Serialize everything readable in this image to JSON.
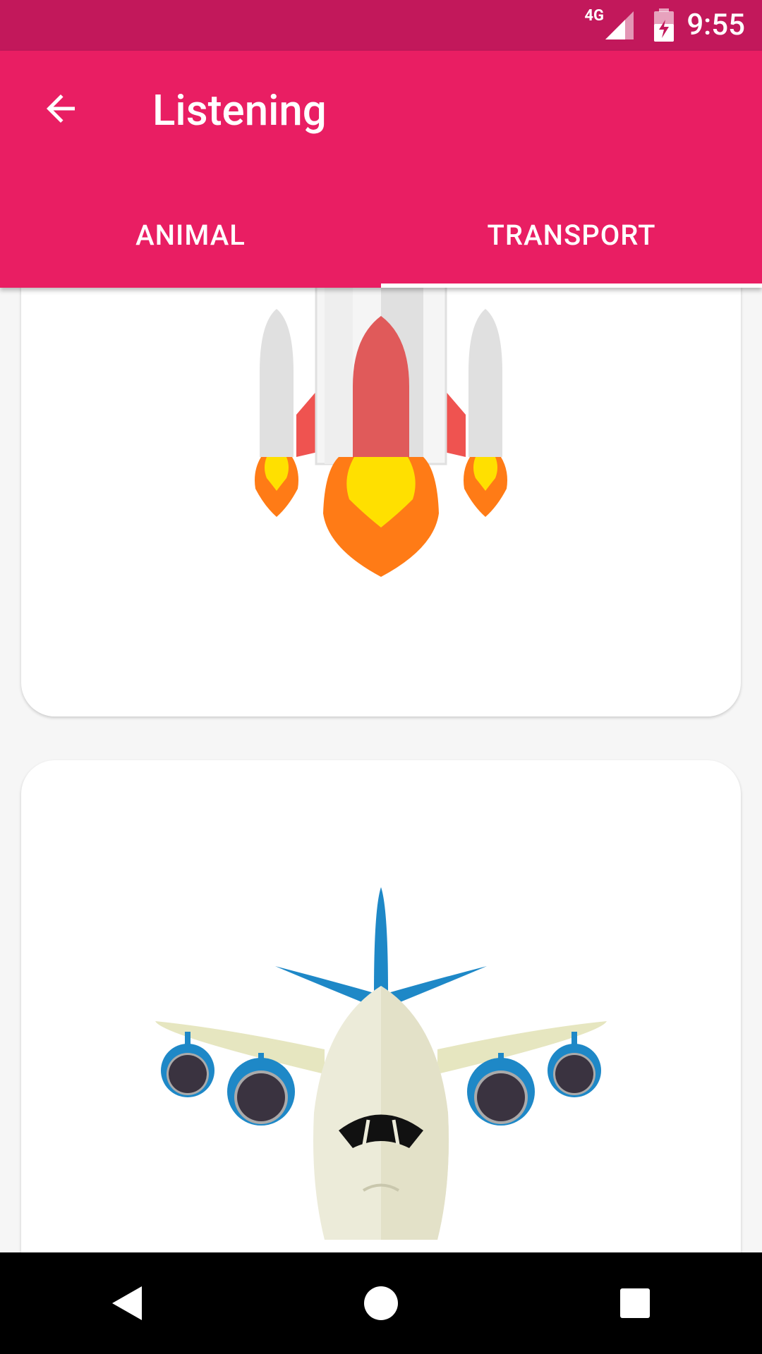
{
  "status_bar": {
    "time": "9:55",
    "network": "4G"
  },
  "app_bar": {
    "title": "Listening"
  },
  "tabs": [
    {
      "label": "ANIMAL",
      "active": false
    },
    {
      "label": "TRANSPORT",
      "active": true
    }
  ],
  "cards": [
    {
      "illustration": "rocket-illustration"
    },
    {
      "illustration": "airplane-illustration"
    }
  ],
  "colors": {
    "status": "#c2185b",
    "primary": "#e91e63"
  }
}
